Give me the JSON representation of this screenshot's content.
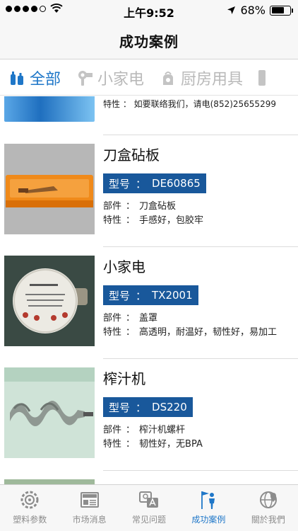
{
  "status_bar": {
    "time": "上午9:52",
    "battery_percent": "68%",
    "battery_level": 0.68
  },
  "nav": {
    "title": "成功案例"
  },
  "category_tabs": [
    {
      "label": "全部",
      "icon": "bottles-icon",
      "active": true
    },
    {
      "label": "小家电",
      "icon": "hair-dryer-icon",
      "active": false
    },
    {
      "label": "厨房用具",
      "icon": "kettle-icon",
      "active": false
    }
  ],
  "partial_item": {
    "text": "特性 ： 如要联络我们，请电(852)25655299"
  },
  "items": [
    {
      "title": "刀盒砧板",
      "model_label": "型号",
      "model_sep": "：",
      "model": "DE60865",
      "part_label": "部件",
      "part_sep": "：",
      "part": "刀盒砧板",
      "feature_label": "特性",
      "feature_sep": "：",
      "feature": "手感好，包胶牢"
    },
    {
      "title": "小家电",
      "model_label": "型号",
      "model_sep": "：",
      "model": "TX2001",
      "part_label": "部件",
      "part_sep": "：",
      "part": "盖罩",
      "feature_label": "特性",
      "feature_sep": "：",
      "feature": "高透明，耐温好，韧性好，易加工"
    },
    {
      "title": "榨汁机",
      "model_label": "型号",
      "model_sep": "：",
      "model": "DS220",
      "part_label": "部件",
      "part_sep": "：",
      "part": "榨汁机螺杆",
      "feature_label": "特性",
      "feature_sep": "：",
      "feature": "韧性好，无BPA"
    }
  ],
  "tab_bar": [
    {
      "label": "塑料参数",
      "icon": "gear-globe-icon",
      "active": false
    },
    {
      "label": "市场消息",
      "icon": "newspaper-icon",
      "active": false
    },
    {
      "label": "常见问题",
      "icon": "faq-icon",
      "active": false
    },
    {
      "label": "成功案例",
      "icon": "flag-person-icon",
      "active": true
    },
    {
      "label": "關於我們",
      "icon": "globe-pin-icon",
      "active": false
    }
  ],
  "colors": {
    "accent": "#1f77c8",
    "badge": "#19589b",
    "inactive": "#b9b9b9"
  }
}
